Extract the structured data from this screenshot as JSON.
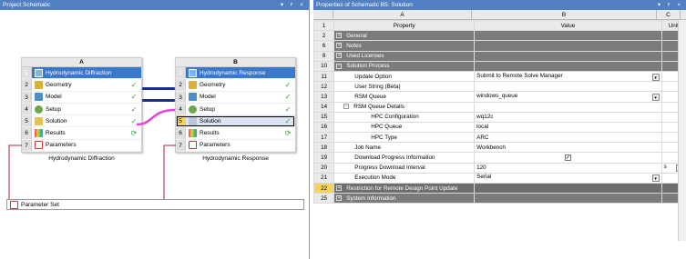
{
  "left_panel": {
    "title": "Project Schematic",
    "title_buttons": "▾ ᵖ × "
  },
  "system_a": {
    "column": "A",
    "caption": "Hydrodynamic Diffraction",
    "rows": [
      {
        "n": "1",
        "label": "Hydrodynamic Diffraction",
        "status": ""
      },
      {
        "n": "2",
        "label": "Geometry",
        "status": "✓"
      },
      {
        "n": "3",
        "label": "Model",
        "status": "✓"
      },
      {
        "n": "4",
        "label": "Setup",
        "status": "✓"
      },
      {
        "n": "5",
        "label": "Solution",
        "status": "✓"
      },
      {
        "n": "6",
        "label": "Results",
        "status": "⟳"
      },
      {
        "n": "7",
        "label": "Parameters",
        "status": ""
      }
    ]
  },
  "system_b": {
    "column": "B",
    "caption": "Hydrodynamic Response",
    "rows": [
      {
        "n": "1",
        "label": "Hydrodynamic Response",
        "status": ""
      },
      {
        "n": "2",
        "label": "Geometry",
        "status": "✓"
      },
      {
        "n": "3",
        "label": "Model",
        "status": "✓"
      },
      {
        "n": "4",
        "label": "Setup",
        "status": "✓"
      },
      {
        "n": "5",
        "label": "Solution",
        "status": "✓"
      },
      {
        "n": "6",
        "label": "Results",
        "status": "⟳"
      },
      {
        "n": "7",
        "label": "Parameters",
        "status": ""
      }
    ]
  },
  "parameter_set": "Parameter Set",
  "right_panel": {
    "title": "Properties of Schematic B5: Solution",
    "title_buttons": "▾ ᵖ × ",
    "col_letters": [
      "A",
      "B",
      "C"
    ],
    "col_headers": {
      "n": "1",
      "property": "Property",
      "value": "Value",
      "unit": "Unit"
    },
    "rows": [
      {
        "n": "2",
        "type": "grp",
        "prop": "General",
        "value": "",
        "unit": ""
      },
      {
        "n": "6",
        "type": "grp",
        "prop": "Notes",
        "value": "",
        "unit": ""
      },
      {
        "n": "8",
        "type": "grp",
        "prop": "Used Licenses",
        "value": "",
        "unit": ""
      },
      {
        "n": "10",
        "type": "grp-open",
        "prop": "Solution Process",
        "value": "",
        "unit": ""
      },
      {
        "n": "11",
        "type": "prop",
        "prop": "Update Option",
        "value": "Submit to Remote Solve Manager",
        "unit": "",
        "dd": true
      },
      {
        "n": "12",
        "type": "prop",
        "prop": "User String (Beta)",
        "value": "",
        "unit": ""
      },
      {
        "n": "13",
        "type": "prop",
        "prop": "RSM Queue",
        "value": "windows_queue",
        "unit": "",
        "dd": true
      },
      {
        "n": "14",
        "type": "sub",
        "prop": "RSM Queue Details",
        "value": "",
        "unit": ""
      },
      {
        "n": "15",
        "type": "prop2",
        "prop": "HPC Configuration",
        "value": "wq12c",
        "unit": ""
      },
      {
        "n": "16",
        "type": "prop2",
        "prop": "HPC Queue",
        "value": "local",
        "unit": ""
      },
      {
        "n": "17",
        "type": "prop2",
        "prop": "HPC Type",
        "value": "ARC",
        "unit": ""
      },
      {
        "n": "18",
        "type": "prop",
        "prop": "Job Name",
        "value": "Workbench",
        "unit": ""
      },
      {
        "n": "19",
        "type": "prop",
        "prop": "Download Progress Information",
        "value": "✓",
        "unit": "",
        "check": true
      },
      {
        "n": "20",
        "type": "prop",
        "prop": "Progress Download Interval",
        "value": "120",
        "unit": "s",
        "unitdd": true
      },
      {
        "n": "21",
        "type": "prop",
        "prop": "Execution Mode",
        "value": "Serial",
        "unit": "",
        "dd": true
      },
      {
        "n": "22",
        "type": "sel",
        "prop": "Restriction for Remote Design Point Update",
        "value": "",
        "unit": ""
      },
      {
        "n": "25",
        "type": "grp",
        "prop": "System Information",
        "value": "",
        "unit": ""
      }
    ]
  }
}
